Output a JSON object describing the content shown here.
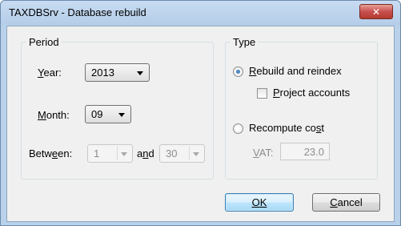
{
  "window": {
    "title": "TAXDBSrv - Database rebuild",
    "close_icon": "✕"
  },
  "period": {
    "legend": "Period",
    "year_label": "Year:",
    "year_value": "2013",
    "month_label": "Month:",
    "month_value": "09",
    "between_label": "Between:",
    "between_from": "1",
    "and_label": "and",
    "between_to": "30"
  },
  "type": {
    "legend": "Type",
    "rebuild_label": "Rebuild and reindex",
    "rebuild_selected": true,
    "project_accounts_label": "Project accounts",
    "project_accounts_checked": false,
    "recompute_label": "Recompute cost",
    "recompute_selected": false,
    "vat_label": "VAT:",
    "vat_value": "23.0"
  },
  "buttons": {
    "ok": "OK",
    "cancel": "Cancel"
  }
}
